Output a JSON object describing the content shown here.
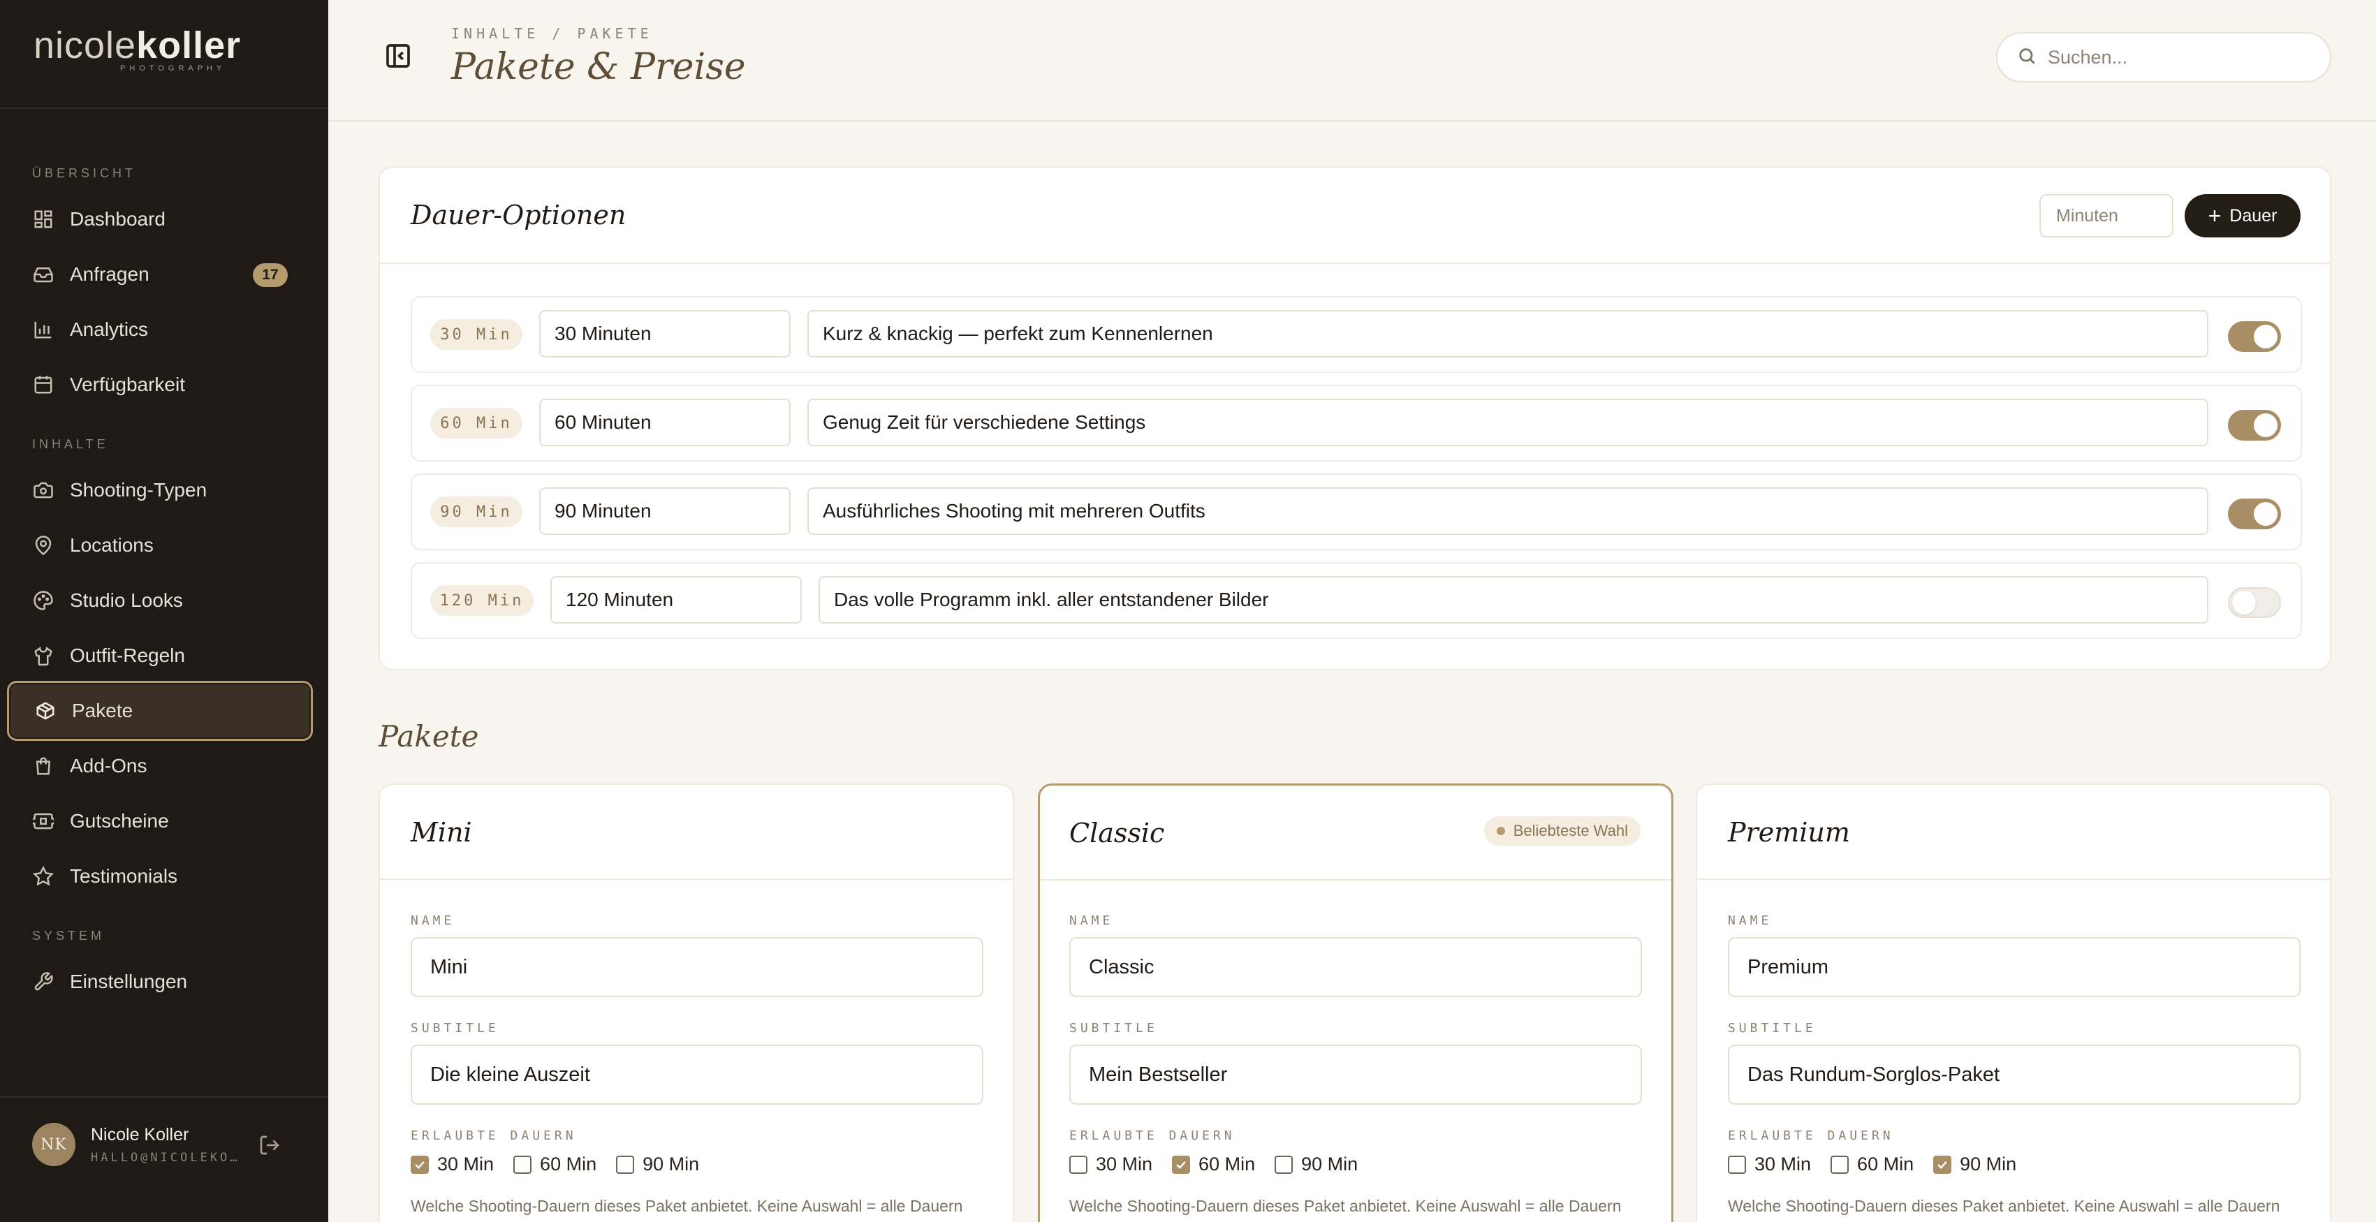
{
  "brand": {
    "logo_thin": "nicole",
    "logo_bold": "koller",
    "logo_sub": "PHOTOGRAPHY"
  },
  "sidebar": {
    "sections": [
      "ÜBERSICHT",
      "INHALTE",
      "SYSTEM"
    ],
    "items": [
      {
        "label": "Dashboard",
        "icon": "grid-icon"
      },
      {
        "label": "Anfragen",
        "icon": "inbox-icon",
        "badge": "17"
      },
      {
        "label": "Analytics",
        "icon": "bar-chart-icon"
      },
      {
        "label": "Verfügbarkeit",
        "icon": "calendar-icon"
      },
      {
        "label": "Shooting-Typen",
        "icon": "camera-icon"
      },
      {
        "label": "Locations",
        "icon": "map-pin-icon"
      },
      {
        "label": "Studio Looks",
        "icon": "palette-icon"
      },
      {
        "label": "Outfit-Regeln",
        "icon": "shirt-icon"
      },
      {
        "label": "Pakete",
        "icon": "package-icon",
        "active": true
      },
      {
        "label": "Add-Ons",
        "icon": "shopping-bag-icon"
      },
      {
        "label": "Gutscheine",
        "icon": "ticket-icon"
      },
      {
        "label": "Testimonials",
        "icon": "star-icon"
      },
      {
        "label": "Einstellungen",
        "icon": "wrench-icon"
      }
    ],
    "user": {
      "initials": "NK",
      "name": "Nicole Koller",
      "email": "HALLO@NICOLEKO…"
    }
  },
  "header": {
    "breadcrumb": "INHALTE / PAKETE",
    "title": "Pakete & Preise",
    "search_placeholder": "Suchen..."
  },
  "durations": {
    "title": "Dauer-Optionen",
    "minutes_placeholder": "Minuten",
    "add_label": "Dauer",
    "rows": [
      {
        "pill": "30 Min",
        "label": "30 Minuten",
        "description": "Kurz & knackig — perfekt zum Kennenlernen",
        "enabled": true
      },
      {
        "pill": "60 Min",
        "label": "60 Minuten",
        "description": "Genug Zeit für verschiedene Settings",
        "enabled": true
      },
      {
        "pill": "90 Min",
        "label": "90 Minuten",
        "description": "Ausführliches Shooting mit mehreren Outfits",
        "enabled": true
      },
      {
        "pill": "120 Min",
        "label": "120 Minuten",
        "description": "Das volle Programm inkl. aller entstandener Bilder",
        "enabled": false
      }
    ]
  },
  "packages": {
    "heading": "Pakete",
    "labels": {
      "name": "NAME",
      "subtitle": "SUBTITLE",
      "durations": "ERLAUBTE DAUERN"
    },
    "hint": "Welche Shooting-Dauern dieses Paket anbietet. Keine Auswahl = alle Dauern",
    "duration_options": [
      "30 Min",
      "60 Min",
      "90 Min"
    ],
    "items": [
      {
        "title": "Mini",
        "name": "Mini",
        "subtitle": "Die kleine Auszeit",
        "checked": [
          true,
          false,
          false
        ]
      },
      {
        "title": "Classic",
        "name": "Classic",
        "subtitle": "Mein Bestseller",
        "badge": "Beliebteste Wahl",
        "checked": [
          false,
          true,
          false
        ]
      },
      {
        "title": "Premium",
        "name": "Premium",
        "subtitle": "Das Rundum-Sorglos-Paket",
        "checked": [
          false,
          false,
          true
        ]
      }
    ]
  },
  "colors": {
    "sidebar_bg": "#1f1a16",
    "accent": "#b59a6c",
    "page_bg": "#f8f5ef"
  }
}
